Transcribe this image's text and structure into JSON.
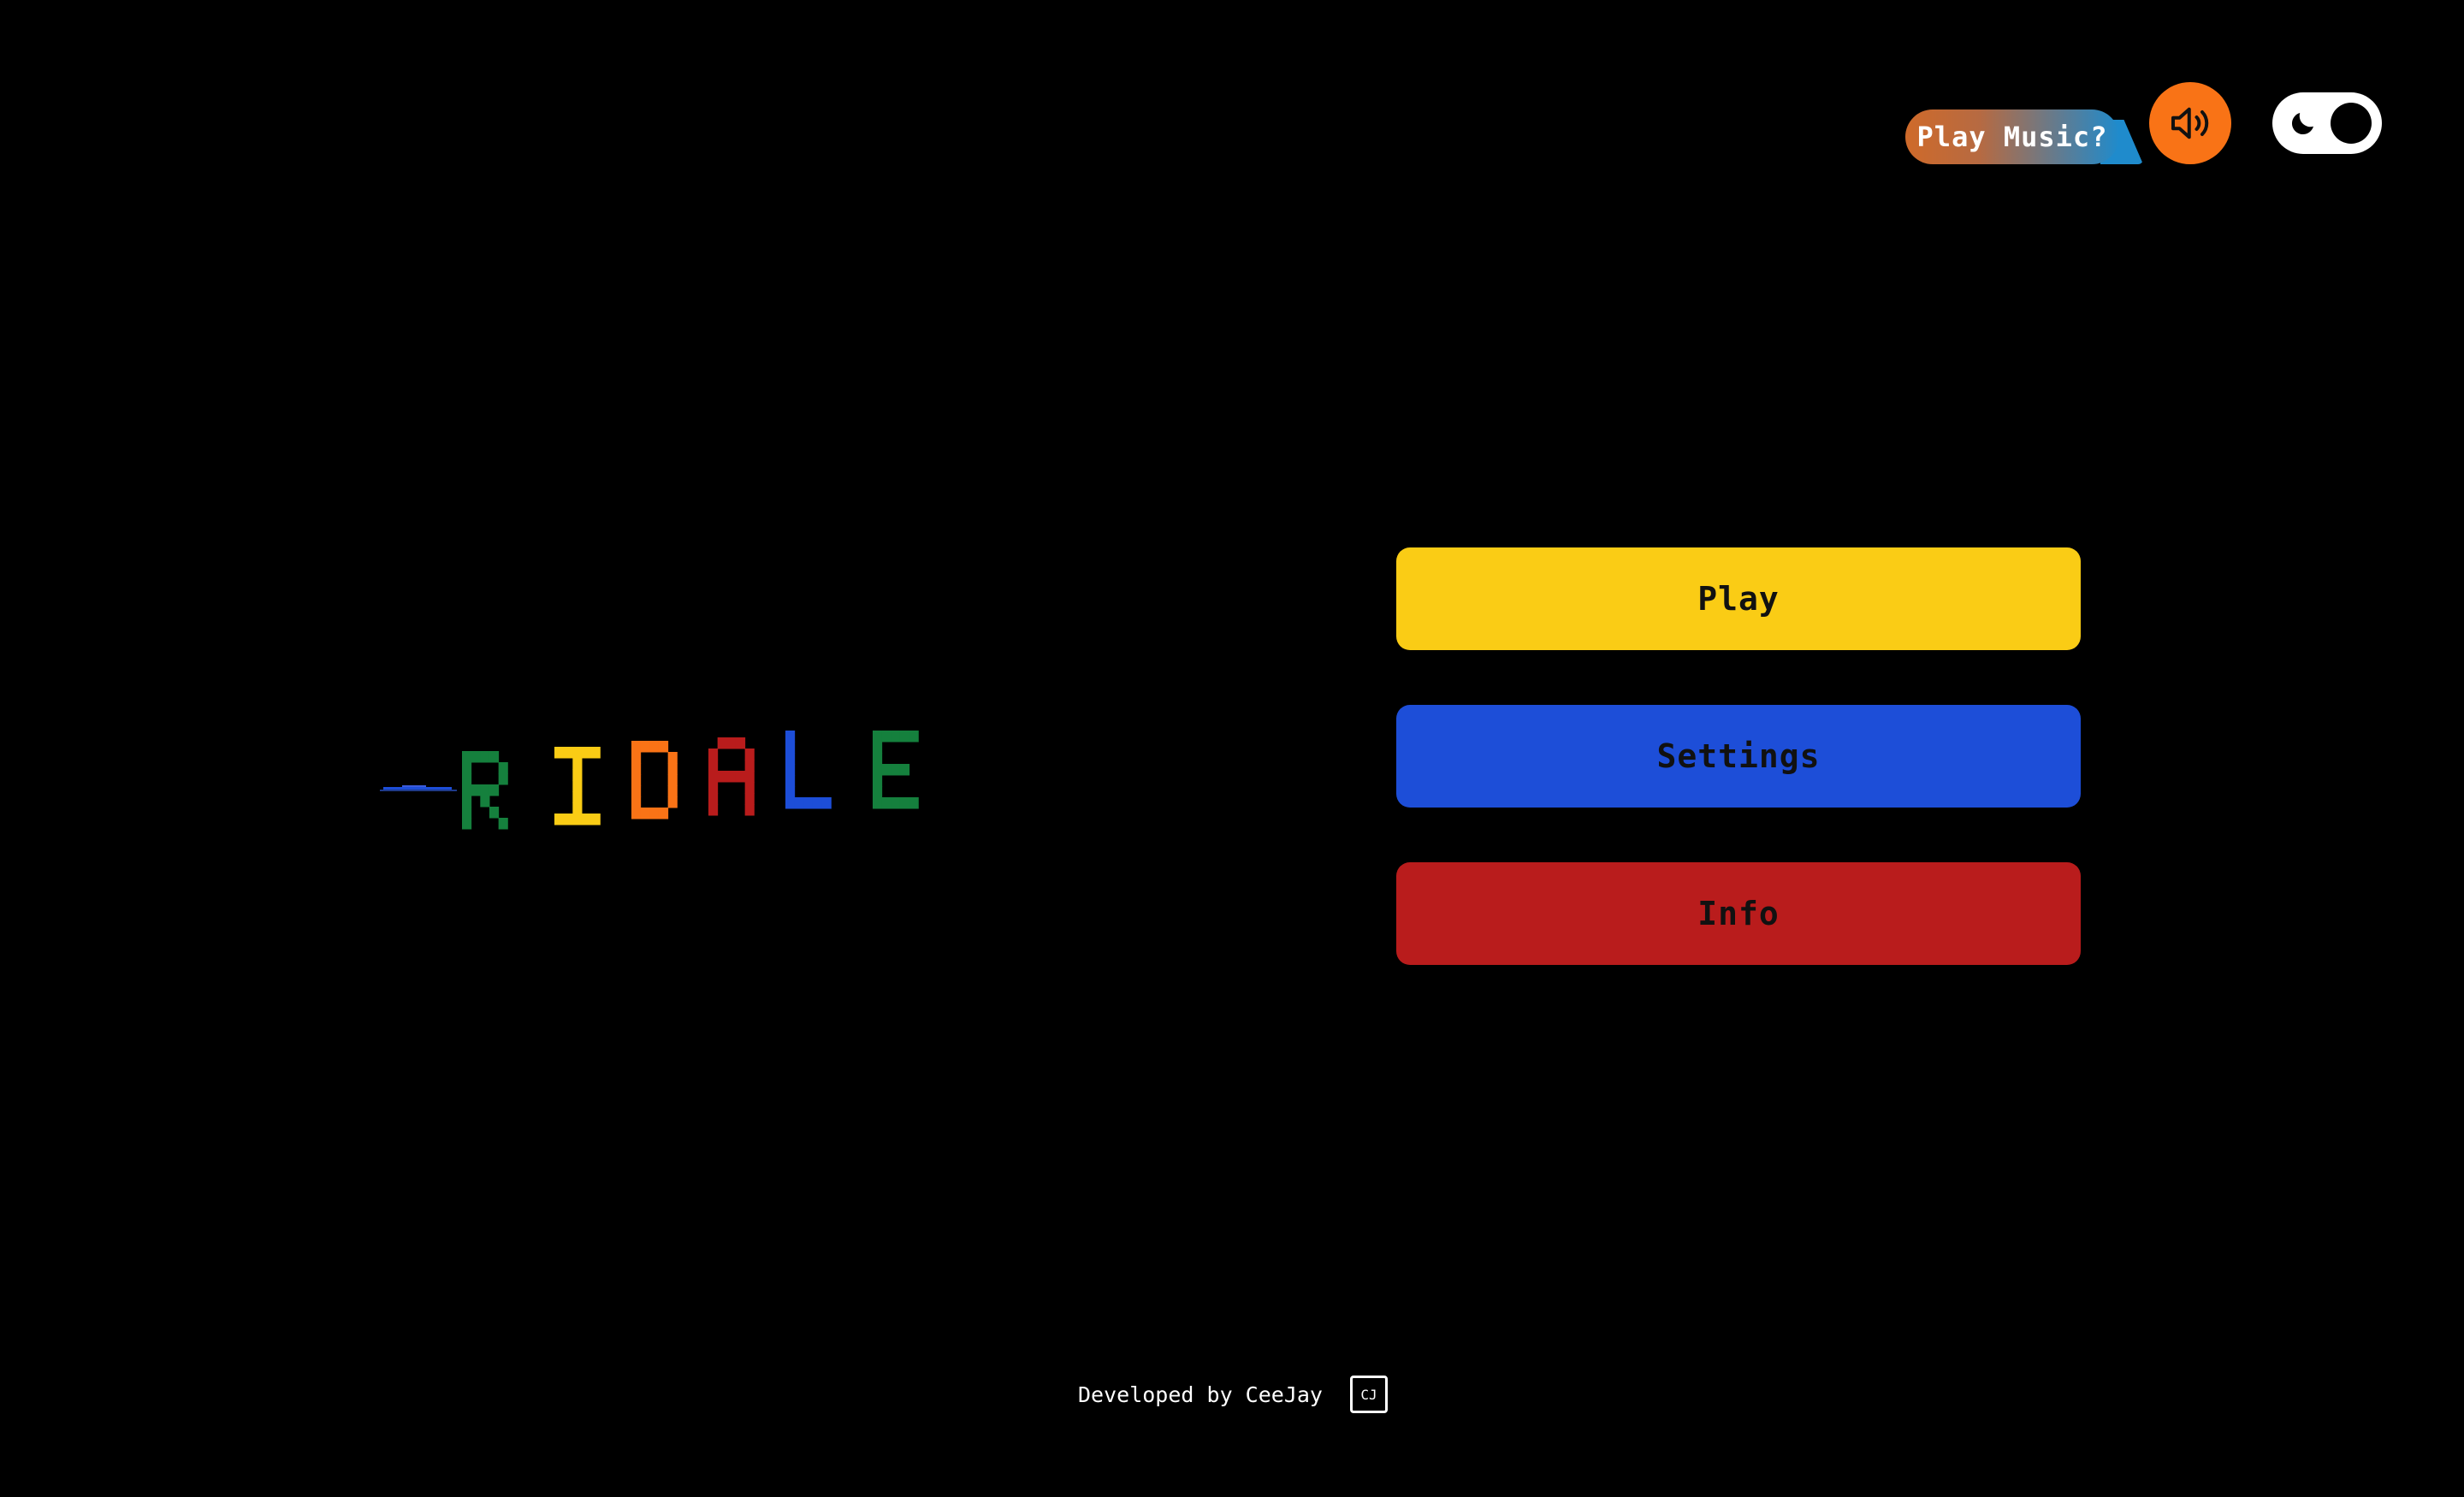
{
  "header": {
    "music_prompt": "Play Music?",
    "sound_icon": "speaker-sound-icon",
    "theme_icon": "moon-icon"
  },
  "logo": {
    "letters": [
      {
        "char": "R",
        "color": "#15803d"
      },
      {
        "char": "I",
        "color": "#facc15"
      },
      {
        "char": "D",
        "color": "#f97316"
      },
      {
        "char": "A",
        "color": "#b91c1c"
      },
      {
        "char": "L",
        "color": "#1d4ed8"
      },
      {
        "char": "E",
        "color": "#15803d"
      }
    ]
  },
  "menu": {
    "play_label": "Play",
    "settings_label": "Settings",
    "info_label": "Info"
  },
  "footer": {
    "credit": "Developed by CeeJay",
    "logo_text": "CJ"
  },
  "colors": {
    "background": "#000000",
    "accent_orange": "#f97316",
    "play": "#facc15",
    "settings": "#1d4ed8",
    "info": "#b91c1c"
  }
}
